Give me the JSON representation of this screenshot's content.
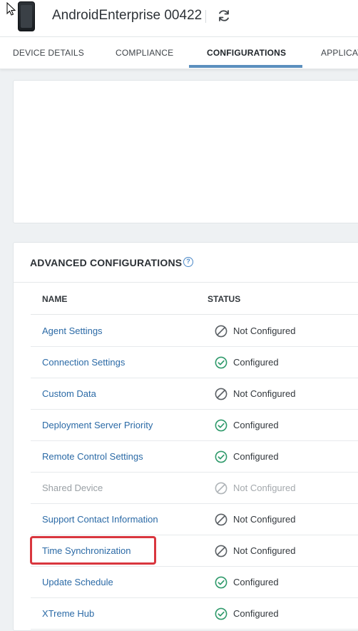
{
  "header": {
    "title": "AndroidEnterprise 00422"
  },
  "tabs": [
    {
      "label": "DEVICE DETAILS",
      "active": false
    },
    {
      "label": "COMPLIANCE",
      "active": false
    },
    {
      "label": "CONFIGURATIONS",
      "active": true
    },
    {
      "label": "APPLICAT",
      "active": false
    }
  ],
  "advanced": {
    "title": "ADVANCED CONFIGURATIONS",
    "columns": {
      "name": "NAME",
      "status": "STATUS"
    },
    "rows": [
      {
        "name": "Agent Settings",
        "status": "Not Configured",
        "state": "not-configured",
        "disabled": false
      },
      {
        "name": "Connection Settings",
        "status": "Configured",
        "state": "configured",
        "disabled": false
      },
      {
        "name": "Custom Data",
        "status": "Not Configured",
        "state": "not-configured",
        "disabled": false
      },
      {
        "name": "Deployment Server Priority",
        "status": "Configured",
        "state": "configured",
        "disabled": false
      },
      {
        "name": "Remote Control Settings",
        "status": "Configured",
        "state": "configured",
        "disabled": false
      },
      {
        "name": "Shared Device",
        "status": "Not Configured",
        "state": "not-configured",
        "disabled": true
      },
      {
        "name": "Support Contact Information",
        "status": "Not Configured",
        "state": "not-configured",
        "disabled": false
      },
      {
        "name": "Time Synchronization",
        "status": "Not Configured",
        "state": "not-configured",
        "disabled": false,
        "highlighted": true
      },
      {
        "name": "Update Schedule",
        "status": "Configured",
        "state": "configured",
        "disabled": false
      },
      {
        "name": "XTreme Hub",
        "status": "Configured",
        "state": "configured",
        "disabled": false
      }
    ]
  },
  "colors": {
    "link": "#2b6aa6",
    "configured": "#2f9a6b",
    "not_configured": "#5b6065",
    "highlight": "#d9363e",
    "tab_active": "#5b8fbe"
  },
  "icons": {
    "refresh": "refresh-icon",
    "help": "help-icon",
    "configured": "check-circle-icon",
    "not_configured": "ban-icon"
  }
}
